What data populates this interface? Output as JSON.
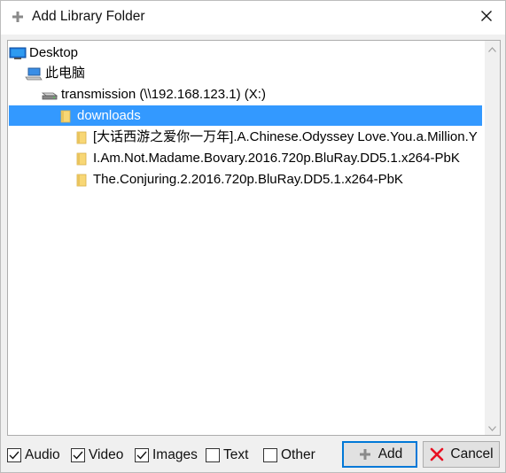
{
  "window": {
    "title": "Add Library Folder",
    "title_icon": "plus-icon",
    "close_icon": "close-icon"
  },
  "tree": {
    "nodes": [
      {
        "label": "Desktop",
        "icon": "desktop-icon",
        "level": 0,
        "selected": false
      },
      {
        "label": "此电脑",
        "icon": "computer-icon",
        "level": 1,
        "selected": false
      },
      {
        "label": "transmission (\\\\192.168.123.1) (X:)",
        "icon": "network-drive-icon",
        "level": 2,
        "selected": false
      },
      {
        "label": "downloads",
        "icon": "folder-icon",
        "level": 3,
        "selected": true
      },
      {
        "label": "[大话西游之爱你一万年].A.Chinese.Odyssey Love.You.a.Million.Y",
        "icon": "folder-icon",
        "level": 4,
        "selected": false
      },
      {
        "label": "I.Am.Not.Madame.Bovary.2016.720p.BluRay.DD5.1.x264-PbK",
        "icon": "folder-icon",
        "level": 4,
        "selected": false
      },
      {
        "label": "The.Conjuring.2.2016.720p.BluRay.DD5.1.x264-PbK",
        "icon": "folder-icon",
        "level": 4,
        "selected": false
      }
    ]
  },
  "filters": [
    {
      "label": "Audio",
      "checked": true
    },
    {
      "label": "Video",
      "checked": true
    },
    {
      "label": "Images",
      "checked": true
    },
    {
      "label": "Text",
      "checked": false
    },
    {
      "label": "Other",
      "checked": false
    }
  ],
  "buttons": {
    "add_label": "Add",
    "add_icon": "plus-icon",
    "cancel_label": "Cancel",
    "cancel_icon": "red-x-icon"
  },
  "colors": {
    "selection": "#3399ff",
    "default_button_border": "#0078d7",
    "folder": "#f8d775",
    "cancel_x": "#e81123"
  }
}
